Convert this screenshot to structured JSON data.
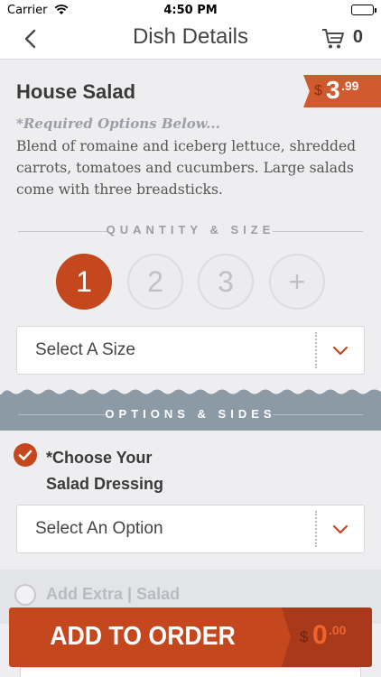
{
  "status_bar": {
    "carrier": "Carrier",
    "time": "4:50 PM"
  },
  "nav": {
    "title": "Dish Details",
    "cart_count": "0"
  },
  "dish": {
    "name": "House Salad",
    "price_currency": "$",
    "price_whole": "3",
    "price_cents": ".99",
    "required_note": "*Required Options Below...",
    "description": "Blend of romaine and iceberg lettuce, shredded carrots, tomatoes and cucumbers. Large salads come with three breadsticks."
  },
  "quantity_size": {
    "heading": "QUANTITY & SIZE",
    "options": [
      "1",
      "2",
      "3",
      "+"
    ],
    "selected": "1",
    "size_select": "Select A Size"
  },
  "options_sides": {
    "heading": "OPTIONS & SIDES",
    "dressing_label_line1": "*Choose Your",
    "dressing_label_line2": "Salad Dressing",
    "dressing_select": "Select An Option",
    "extra_label": "Add Extra | Salad"
  },
  "add_to_order": {
    "label": "ADD TO ORDER",
    "total_currency": "$",
    "total_whole": "0",
    "total_cents": ".00"
  },
  "colors": {
    "accent": "#c4471e",
    "band": "#8c9aa5"
  }
}
